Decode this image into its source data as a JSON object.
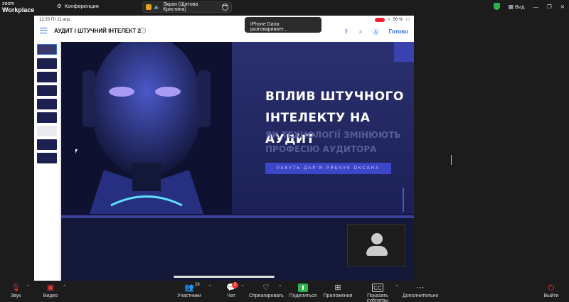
{
  "app": {
    "logo_top": "zoom",
    "logo_bottom": "Workplace"
  },
  "topbar": {
    "conference": "Конференция",
    "share_pill": "Экран (Щитова Кристина)",
    "view_label": "Вид",
    "shield_color": "#2bb24c"
  },
  "ipad": {
    "time": "12:20",
    "date": "Пт 11 апр.",
    "battery": "56 %",
    "doc_title": "АУДИТ І ШТУЧНИЙ ІНТЕЛЕКТ 2",
    "done": "Готово"
  },
  "notification": {
    "text": "iPhone Daria разговаривает..."
  },
  "slide": {
    "title": "ВПЛИВ ШТУЧНОГО ІНТЕЛЕКТУ НА АУДИТ",
    "subtitle": "ЯК ТЕХНОЛОГІЇ ЗМІНЮЮТЬ ПРОФЕСІЮ АУДИТОРА",
    "authors": "РАКУТЬ ДАР'Я,РЯБЧУК ОКСАНА",
    "accent": "#3b46c9"
  },
  "toolbar": {
    "audio": "Звук",
    "video": "Видео",
    "participants": "Участники",
    "participants_count": "28",
    "chat": "Чат",
    "chat_badge": "2",
    "react": "Отреагировать",
    "share": "Поделиться",
    "apps": "Приложения",
    "captions": "Показать субтитры",
    "more": "Дополнительно",
    "leave": "Выйти"
  }
}
